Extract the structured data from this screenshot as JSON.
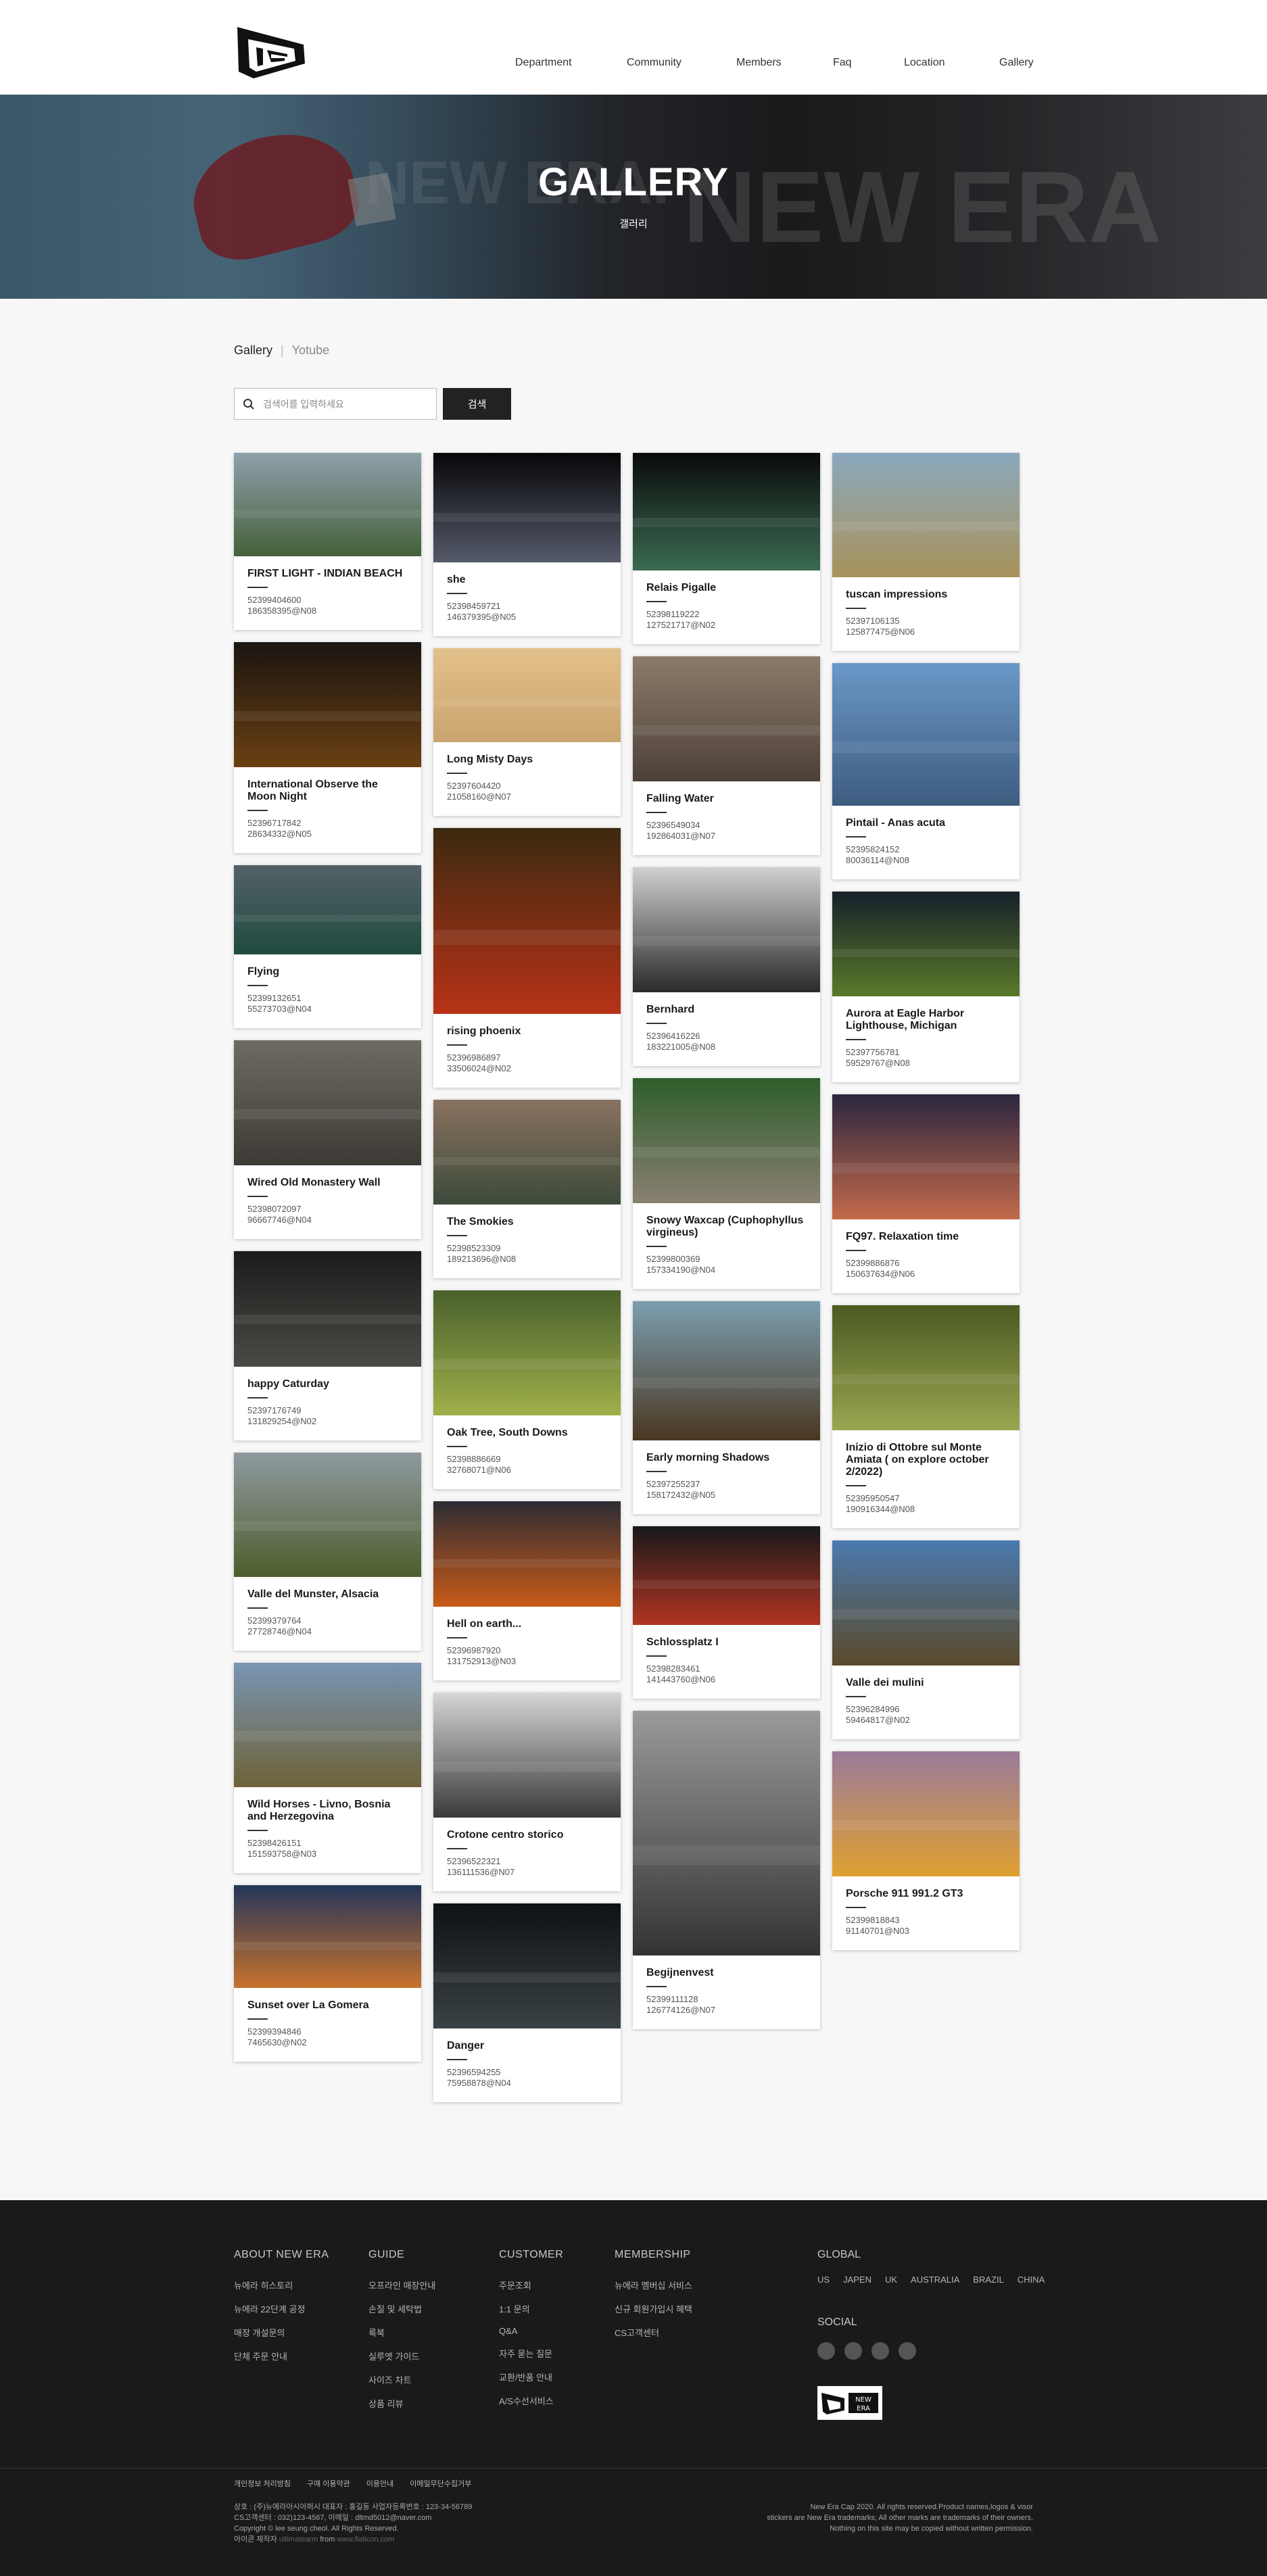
{
  "header": {
    "logo_alt": "New Era",
    "nav": [
      "Department",
      "Community",
      "Members",
      "Faq",
      "Location",
      "Gallery"
    ]
  },
  "hero": {
    "title": "GALLERY",
    "subtitle": "갤러리",
    "bg_text_1": "NEW ERA.",
    "bg_text_2": "NEW ERA"
  },
  "tabs": {
    "active": "Gallery",
    "other": "Yotube"
  },
  "search": {
    "placeholder": "검색어를 입력하세요",
    "button": "검색"
  },
  "gallery": {
    "columns": [
      [
        {
          "title": "FIRST LIGHT - INDIAN BEACH",
          "line1": "52399404600",
          "line2": "186358395@N08",
          "img": "sea-cliff",
          "colors": [
            "#8ea0ab",
            "#45603a"
          ]
        },
        {
          "title": "International Observe the Moon Night",
          "line1": "52396717842",
          "line2": "28634332@N05",
          "img": "city-moon",
          "colors": [
            "#1a1410",
            "#6a4012"
          ]
        },
        {
          "title": "Flying",
          "line1": "52399132651",
          "line2": "55273703@N04",
          "img": "wave",
          "colors": [
            "#546068",
            "#1f4b40"
          ]
        },
        {
          "title": "Wired Old Monastery Wall",
          "line1": "52398072097",
          "line2": "96667746@N04",
          "img": "stone-wall",
          "colors": [
            "#6e6b63",
            "#3c3a34"
          ]
        },
        {
          "title": "happy Caturday",
          "line1": "52397176749",
          "line2": "131829254@N02",
          "img": "cat",
          "colors": [
            "#1b1b1b",
            "#4a4a45"
          ]
        },
        {
          "title": "Valle del Munster, Alsacia",
          "line1": "52399379764",
          "line2": "27728746@N04",
          "img": "vineyard",
          "colors": [
            "#8f9aa0",
            "#4e5d2c"
          ]
        },
        {
          "title": "Wild Horses - Livno, Bosnia and Herzegovina",
          "line1": "52398426151",
          "line2": "151593758@N03",
          "img": "horses",
          "colors": [
            "#7895b3",
            "#6e6238"
          ]
        },
        {
          "title": "Sunset over La Gomera",
          "line1": "52399394846",
          "line2": "7465630@N02",
          "img": "sunset-coast",
          "colors": [
            "#23355a",
            "#c8722d"
          ]
        }
      ],
      [
        {
          "title": "she",
          "line1": "52398459721",
          "line2": "146379395@N05",
          "img": "light-tunnel",
          "colors": [
            "#070709",
            "#555a6a"
          ]
        },
        {
          "title": "Long Misty Days",
          "line1": "52397604420",
          "line2": "21058160@N07",
          "img": "misty-beach",
          "colors": [
            "#e3c18a",
            "#c9a46f"
          ]
        },
        {
          "title": "rising phoenix",
          "line1": "52396986897",
          "line2": "33506024@N02",
          "img": "red-flower",
          "colors": [
            "#3c2a10",
            "#b83217"
          ]
        },
        {
          "title": "The Smokies",
          "line1": "52398523309",
          "line2": "189213696@N08",
          "img": "mountains",
          "colors": [
            "#8a7260",
            "#3c4a3a"
          ]
        },
        {
          "title": "Oak Tree, South Downs",
          "line1": "52398886669",
          "line2": "32768071@N06",
          "img": "oak-tree",
          "colors": [
            "#49602c",
            "#9fb04a"
          ]
        },
        {
          "title": "Hell on earth...",
          "line1": "52396987920",
          "line2": "131752913@N03",
          "img": "fire-sky",
          "colors": [
            "#2c2c34",
            "#c85a18"
          ]
        },
        {
          "title": "Crotone centro storico",
          "line1": "52396522321",
          "line2": "136111536@N07",
          "img": "alley-bw",
          "colors": [
            "#d6d6d6",
            "#3a3a3a"
          ]
        },
        {
          "title": "Danger",
          "line1": "52396594255",
          "line2": "75958878@N04",
          "img": "dark-road",
          "colors": [
            "#0e1113",
            "#3a4246"
          ]
        }
      ],
      [
        {
          "title": "Relais Pigalle",
          "line1": "52398119222",
          "line2": "127521717@N02",
          "img": "night-shop",
          "colors": [
            "#0a0a0a",
            "#3a6b52"
          ]
        },
        {
          "title": "Falling Water",
          "line1": "52396549034",
          "line2": "192864031@N07",
          "img": "steps",
          "colors": [
            "#8b7b6a",
            "#4d4038"
          ]
        },
        {
          "title": "Bernhard",
          "line1": "52396416226",
          "line2": "183221005@N08",
          "img": "portrait-bw",
          "colors": [
            "#d0d0d0",
            "#2a2a2a"
          ]
        },
        {
          "title": "Snowy Waxcap (Cuphophyllus virgineus)",
          "line1": "52399800369",
          "line2": "157334190@N04",
          "img": "mushroom",
          "colors": [
            "#2d5e2a",
            "#8a8072"
          ]
        },
        {
          "title": "Early morning Shadows",
          "line1": "52397255237",
          "line2": "158172432@N05",
          "img": "trees-dawn",
          "colors": [
            "#7a9fb0",
            "#4a3620"
          ]
        },
        {
          "title": "Schlossplatz I",
          "line1": "52398283461",
          "line2": "141443760@N06",
          "img": "subway",
          "colors": [
            "#17181a",
            "#b23422"
          ]
        },
        {
          "title": "Begijnenvest",
          "line1": "52399111128",
          "line2": "126774126@N07",
          "img": "building-bw",
          "colors": [
            "#9a9a9a",
            "#333333"
          ]
        }
      ],
      [
        {
          "title": "tuscan impressions",
          "line1": "52397106135",
          "line2": "125877475@N06",
          "img": "tuscany",
          "colors": [
            "#8aa8bd",
            "#a8925a"
          ]
        },
        {
          "title": "Pintail - Anas acuta",
          "line1": "52395824152",
          "line2": "80036114@N08",
          "img": "duck",
          "colors": [
            "#6a98c8",
            "#3e5c80"
          ]
        },
        {
          "title": "Aurora at Eagle Harbor Lighthouse, Michigan",
          "line1": "52397756781",
          "line2": "59529767@N08",
          "img": "aurora",
          "colors": [
            "#16202a",
            "#5a7a2a"
          ]
        },
        {
          "title": "FQ97. Relaxation time",
          "line1": "52399886876",
          "line2": "150637634@N06",
          "img": "palm-sunset",
          "colors": [
            "#2a2640",
            "#c46a4a"
          ]
        },
        {
          "title": "Inizio di Ottobre sul Monte Amiata ( on explore october 2/2022)",
          "line1": "52395950547",
          "line2": "190916344@N08",
          "img": "forest",
          "colors": [
            "#4a5a22",
            "#9aa650"
          ]
        },
        {
          "title": "Valle dei mulini",
          "line1": "52396284996",
          "line2": "59464817@N02",
          "img": "mill",
          "colors": [
            "#4a7ab0",
            "#5a4a2a"
          ]
        },
        {
          "title": "Porsche 911 991.2 GT3",
          "line1": "52399818843",
          "line2": "91140701@N03",
          "img": "car",
          "colors": [
            "#9a7a9a",
            "#e0a030"
          ]
        }
      ]
    ]
  },
  "footer": {
    "columns": [
      {
        "title": "ABOUT NEW ERA",
        "items": [
          "뉴에라 히스토리",
          "뉴에라 22단계 공정",
          "매장 개설문의",
          "단체 주문 안내"
        ]
      },
      {
        "title": "GUIDE",
        "items": [
          "오프라인 매장안내",
          "손질 및 세탁법",
          "룩북",
          "실루엣 가이드",
          "사이즈 차트",
          "상품 리뷰"
        ]
      },
      {
        "title": "CUSTOMER",
        "items": [
          "주문조회",
          "1:1 문의",
          "Q&A",
          "자주 묻는 질문",
          "교환/반품 안내",
          "A/S수선서비스"
        ]
      },
      {
        "title": "MEMBERSHIP",
        "items": [
          "뉴에라 멤버십 서비스",
          "신규 회원가입시 혜택",
          "CS고객센터"
        ]
      }
    ],
    "global": {
      "title": "GLOBAL",
      "links": [
        "US",
        "JAPEN",
        "UK",
        "AUSTRALIA",
        "BRAZIL",
        "CHINA"
      ]
    },
    "social": {
      "title": "SOCIAL",
      "icons": [
        "youtube-icon",
        "facebook-icon",
        "kakao-icon",
        "instagram-icon"
      ]
    },
    "legal": [
      "개인정보 처리방침",
      "구매 이용약관",
      "이용안내",
      "이메일무단수집거부"
    ],
    "info": [
      "상호 : (주)뉴에라아시아퍼시 대표자 : 홍길동 사업자등록번호 : 123-34-56789",
      "CS고객센터 : 032)123-4567, 이메일 : dltmd5012@naver.com",
      "Copyright © lee seung cheol. All Rights Reserved."
    ],
    "credit_prefix": "아이콘 제작자",
    "credit_author": "ultimatearm",
    "credit_from": "from",
    "credit_site": "www.flaticon.com",
    "right": [
      "New Era Cap 2020. All rights reserved.Product names,logos & visor",
      "stickers are New Era trademarks; All other marks are trademarks of their owners.",
      "Nothing on this site may be copied without written permission."
    ]
  }
}
